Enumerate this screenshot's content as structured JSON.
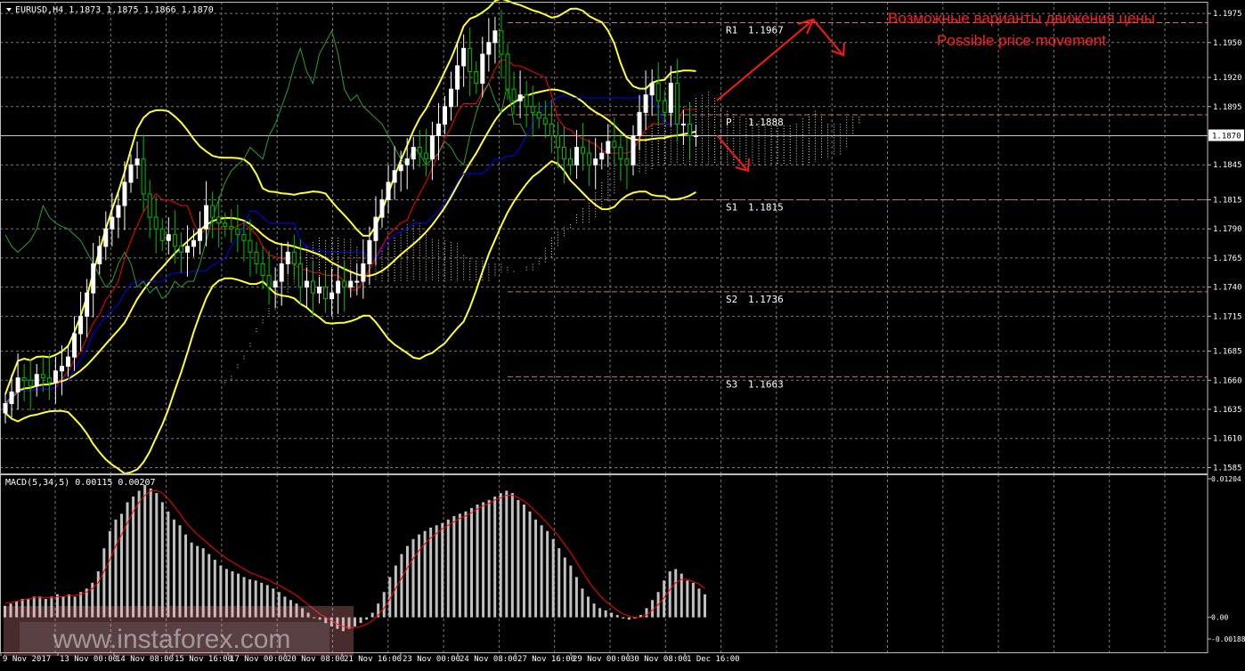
{
  "header": {
    "symbol_info": "EURUSD,H4  1.1873 1.1875 1.1866 1.1870"
  },
  "annotation": {
    "line1": "Возможные варианты движения цены",
    "line2": "Possible price movement",
    "color": "#ff2020"
  },
  "watermark": "www.instaforex.com",
  "colors": {
    "background": "#000000",
    "grid": "#7a7a7a",
    "bull_candle": "#ffffff",
    "bear_candle": "#00c000",
    "bollinger": "#ffff33",
    "tenkan": "#ff0000",
    "kijun": "#0000ff",
    "chikou": "#2ca02c",
    "cloud_a": "#f5deb3",
    "cloud_b": "#cd8c5c",
    "pivot_line": "#c0786a",
    "histogram": "#c0c0c0",
    "signal": "#ff0000"
  },
  "chart_data": [
    {
      "type": "candlestick",
      "symbol": "EURUSD",
      "timeframe": "H4",
      "last_price": "1.1870",
      "ylim": [
        1.158,
        1.1985
      ],
      "y_ticks": [
        "1.1975",
        "1.1950",
        "1.1920",
        "1.1895",
        "1.1870",
        "1.1845",
        "1.1815",
        "1.1790",
        "1.1765",
        "1.1740",
        "1.1715",
        "1.1685",
        "1.1660",
        "1.1635",
        "1.1610",
        "1.1585"
      ],
      "x_ticks": [
        "9 Nov 2017",
        "13 Nov 00:00",
        "14 Nov 08:00",
        "15 Nov 16:00",
        "17 Nov 00:00",
        "20 Nov 08:00",
        "21 Nov 16:00",
        "23 Nov 00:00",
        "24 Nov 08:00",
        "27 Nov 16:00",
        "29 Nov 00:00",
        "30 Nov 08:00",
        "1 Dec 16:00"
      ],
      "close_series": [
        1.164,
        1.165,
        1.1662,
        1.166,
        1.1655,
        1.1665,
        1.1662,
        1.1658,
        1.1668,
        1.1672,
        1.168,
        1.17,
        1.1715,
        1.1735,
        1.176,
        1.1775,
        1.179,
        1.18,
        1.181,
        1.183,
        1.1845,
        1.185,
        1.182,
        1.18,
        1.179,
        1.178,
        1.1785,
        1.1775,
        1.177,
        1.1775,
        1.178,
        1.179,
        1.181,
        1.18,
        1.1795,
        1.1792,
        1.179,
        1.1785,
        1.178,
        1.177,
        1.176,
        1.175,
        1.174,
        1.1745,
        1.176,
        1.177,
        1.176,
        1.174,
        1.1745,
        1.1735,
        1.174,
        1.173,
        1.1735,
        1.1745,
        1.174,
        1.1745,
        1.1745,
        1.176,
        1.178,
        1.18,
        1.1815,
        1.183,
        1.184,
        1.1845,
        1.185,
        1.186,
        1.1855,
        1.185,
        1.187,
        1.188,
        1.1895,
        1.191,
        1.193,
        1.1945,
        1.1925,
        1.1915,
        1.194,
        1.195,
        1.196,
        1.194,
        1.191,
        1.19,
        1.1905,
        1.1895,
        1.189,
        1.1885,
        1.188,
        1.187,
        1.186,
        1.185,
        1.1845,
        1.186,
        1.1855,
        1.1845,
        1.185,
        1.1855,
        1.1865,
        1.186,
        1.185,
        1.1845,
        1.187,
        1.189,
        1.1905,
        1.1915,
        1.19,
        1.189,
        1.1915,
        1.188,
        1.188,
        1.187,
        1.187
      ],
      "pivot_levels": [
        {
          "label": "R1",
          "value": "1.1967"
        },
        {
          "label": "P",
          "value": "1.1888"
        },
        {
          "label": "S1",
          "value": "1.1815"
        },
        {
          "label": "S2",
          "value": "1.1736"
        },
        {
          "label": "S3",
          "value": "1.1663"
        }
      ],
      "indicators": [
        "Bollinger Bands",
        "Ichimoku Kinko Hyo"
      ]
    },
    {
      "type": "bar",
      "title": "MACD(5,34,5) 0.00115 0.00207",
      "ylim": [
        -0.00188,
        0.01204
      ],
      "y_ticks": [
        "0.01204",
        "0.00",
        "-0.00188"
      ],
      "series": [
        {
          "name": "MACD",
          "values": [
            0.001,
            0.0012,
            0.0014,
            0.0016,
            0.0016,
            0.0018,
            0.0018,
            0.0016,
            0.0018,
            0.002,
            0.0018,
            0.002,
            0.0018,
            0.0022,
            0.0025,
            0.003,
            0.004,
            0.006,
            0.0075,
            0.0085,
            0.009,
            0.01,
            0.0105,
            0.011,
            0.0115,
            0.0112,
            0.0108,
            0.01,
            0.0092,
            0.0085,
            0.008,
            0.0072,
            0.0065,
            0.0062,
            0.006,
            0.0055,
            0.005,
            0.0045,
            0.0042,
            0.004,
            0.0038,
            0.0035,
            0.0033,
            0.0032,
            0.003,
            0.0028,
            0.0025,
            0.0022,
            0.0018,
            0.0015,
            0.0012,
            0.0008,
            0.0004,
            0.0,
            -0.0002,
            -0.0005,
            -0.0008,
            -0.001,
            -0.0012,
            -0.001,
            -0.0008,
            -0.0005,
            -0.0002,
            0.0004,
            0.0012,
            0.0022,
            0.0035,
            0.0045,
            0.0055,
            0.0062,
            0.0068,
            0.0072,
            0.0075,
            0.0078,
            0.008,
            0.0082,
            0.0085,
            0.0088,
            0.009,
            0.0092,
            0.0095,
            0.0098,
            0.01,
            0.0102,
            0.0105,
            0.0108,
            0.011,
            0.0108,
            0.0102,
            0.0098,
            0.0092,
            0.0085,
            0.008,
            0.0075,
            0.0068,
            0.006,
            0.0052,
            0.0045,
            0.0035,
            0.0025,
            0.0018,
            0.0012,
            0.0008,
            0.0006,
            0.0004,
            0.0002,
            -0.0001,
            -0.0002,
            -0.0001,
            0.0002,
            0.0008,
            0.0015,
            0.0022,
            0.0032,
            0.004,
            0.0042,
            0.0038,
            0.0032,
            0.003,
            0.0025,
            0.002
          ]
        },
        {
          "name": "Signal",
          "values": [
            0.0012,
            0.0013,
            0.0014,
            0.0015,
            0.0016,
            0.0017,
            0.0017,
            0.0017,
            0.0017,
            0.0018,
            0.0018,
            0.0019,
            0.0019,
            0.002,
            0.0022,
            0.0025,
            0.003,
            0.004,
            0.005,
            0.0062,
            0.0072,
            0.0082,
            0.0092,
            0.01,
            0.0106,
            0.011,
            0.011,
            0.0108,
            0.0103,
            0.0097,
            0.009,
            0.0083,
            0.0077,
            0.0072,
            0.0068,
            0.0063,
            0.0059,
            0.0055,
            0.0051,
            0.0048,
            0.0045,
            0.0042,
            0.0039,
            0.0037,
            0.0035,
            0.0033,
            0.003,
            0.0028,
            0.0025,
            0.0022,
            0.0019,
            0.0015,
            0.0011,
            0.0007,
            0.0003,
            0.0,
            -0.0003,
            -0.0006,
            -0.0008,
            -0.0009,
            -0.0009,
            -0.0008,
            -0.0006,
            -0.0003,
            0.0002,
            0.0008,
            0.0016,
            0.0025,
            0.0034,
            0.0043,
            0.0051,
            0.0058,
            0.0064,
            0.0069,
            0.0073,
            0.0077,
            0.008,
            0.0083,
            0.0086,
            0.0088,
            0.0091,
            0.0094,
            0.0097,
            0.0099,
            0.0102,
            0.0104,
            0.0106,
            0.0106,
            0.0104,
            0.0101,
            0.0097,
            0.0092,
            0.0087,
            0.0082,
            0.0076,
            0.007,
            0.0063,
            0.0056,
            0.0048,
            0.004,
            0.0032,
            0.0025,
            0.0019,
            0.0014,
            0.001,
            0.0006,
            0.0003,
            0.0001,
            0.0,
            0.0,
            0.0002,
            0.0006,
            0.0011,
            0.0017,
            0.0024,
            0.003,
            0.0033,
            0.0033,
            0.0031,
            0.0029,
            0.0025
          ]
        }
      ]
    }
  ]
}
